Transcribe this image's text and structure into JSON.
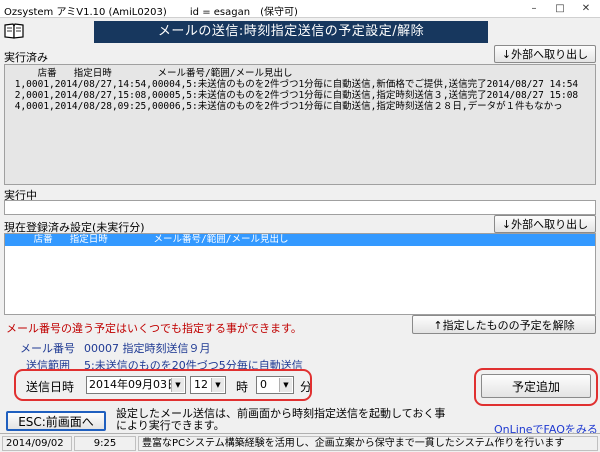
{
  "window": {
    "title": "Ozsystem アミV1.10 (AmiL0203)　　 id = esagan　(保守可)",
    "controls": [
      "–",
      "□",
      "✕"
    ]
  },
  "header": {
    "title": "メールの送信:時刻指定送信の予定設定/解除"
  },
  "executed": {
    "label": "実行済み",
    "export_button": "↓外部へ取り出し",
    "lines": [
      "     店番   指定日時        メール番号/範囲/メール見出し",
      " 1,0001,2014/08/27,14:54,00004,5:未送信のものを2件づつ1分毎に自動送信,新価格でご提供,送信完了2014/08/27 14:54",
      " 2,0001,2014/08/27,15:08,00005,5:未送信のものを2件づつ1分毎に自動送信,指定時刻送信３,送信完了2014/08/27 15:08",
      " 4,0001,2014/08/28,09:25,00006,5:未送信のものを2件づつ1分毎に自動送信,指定時刻送信２８日,データが１件もなかっ"
    ]
  },
  "executing": {
    "label": "実行中"
  },
  "registered": {
    "label": "現在登録済み設定(未実行分)",
    "export_button": "↓外部へ取り出し",
    "header_row": "     店番   指定日時        メール番号/範囲/メール見出し"
  },
  "notice": "メール番号の違う予定はいくつでも指定する事ができます。",
  "cancel_button": "↑指定したものの予定を解除",
  "mail_no": {
    "label": "メール番号",
    "value": "00007  指定時刻送信９月"
  },
  "send_range": {
    "label": "送信範囲",
    "value": "5:未送信のものを20件づつ5分毎に自動送信"
  },
  "schedule": {
    "label": "送信日時",
    "date": "2014年09月03日",
    "hour": "12",
    "hour_unit": "時",
    "minute": "0",
    "minute_unit": "分"
  },
  "add_button": "予定追加",
  "esc_button": "ESC:前画面へ",
  "description": "設定したメール送信は、前画面から時刻指定送信を起動しておく事\nにより実行できます。",
  "faq_link": "OnLineでFAQをみる",
  "status": {
    "date": "2014/09/02",
    "time": "9:25",
    "message": "豊富なPCシステム構築経験を活用し、企画立案から保守まで一貫したシステム作りを行います"
  },
  "colors": {
    "header_bg": "#17375e",
    "selection": "#3399ff",
    "notice": "#c00000",
    "highlight_ring": "#e03030"
  }
}
